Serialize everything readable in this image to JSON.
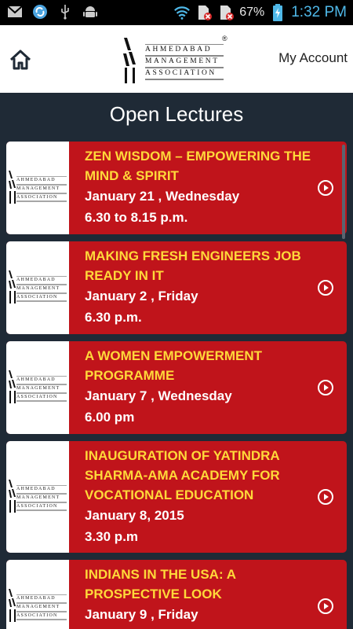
{
  "status_bar": {
    "battery": "67%",
    "time": "1:32 PM",
    "icons": [
      "gmail-icon",
      "sync-icon",
      "usb-icon",
      "android-icon",
      "wifi-icon",
      "sim-error-icon",
      "sim-error-icon",
      "battery-icon"
    ]
  },
  "header": {
    "logo_line1": "AHMEDABAD",
    "logo_line2": "MANAGEMENT",
    "logo_line3": "ASSOCIATION",
    "logo_mark": "®",
    "account": "My Account"
  },
  "page": {
    "title": "Open Lectures"
  },
  "colors": {
    "card_bg": "#c0141b",
    "title_yellow": "#ffd93a",
    "background": "#1f2a36",
    "status_time": "#4fb8e8"
  },
  "lectures": [
    {
      "title": "ZEN WISDOM – EMPOWERING THE MIND & SPIRIT",
      "date": "January 21 , Wednesday",
      "time": "6.30 to 8.15 p.m."
    },
    {
      "title": "MAKING FRESH ENGINEERS JOB READY IN IT",
      "date": "January 2 , Friday",
      "time": "6.30 p.m."
    },
    {
      "title": "A WOMEN EMPOWERMENT PROGRAMME",
      "date": "January 7 , Wednesday",
      "time": "6.00 pm"
    },
    {
      "title": "INAUGURATION OF YATINDRA SHARMA-AMA ACADEMY FOR VOCATIONAL EDUCATION",
      "date": "January 8, 2015",
      "time": "3.30 p.m"
    },
    {
      "title": "INDIANS IN THE USA: A PROSPECTIVE LOOK",
      "date": "January 9 , Friday",
      "time": ""
    }
  ]
}
